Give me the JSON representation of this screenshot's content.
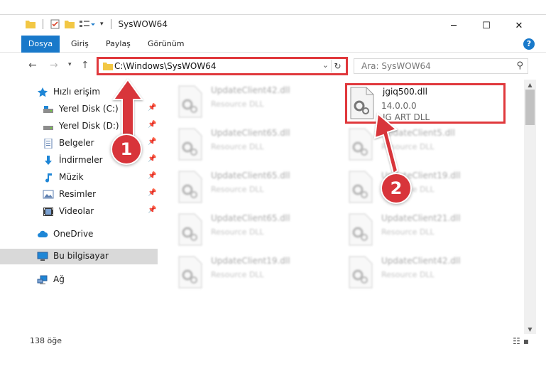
{
  "window": {
    "title": "SysWOW64",
    "controls": {
      "minimize": "─",
      "maximize": "☐",
      "close": "✕"
    }
  },
  "ribbon": {
    "tabs": [
      "Dosya",
      "Giriş",
      "Paylaş",
      "Görünüm"
    ],
    "help": "?"
  },
  "address": {
    "path": "C:\\Windows\\SysWOW64",
    "search_placeholder": "Ara: SysWOW64"
  },
  "sidebar": {
    "quick_access": "Hızlı erişim",
    "pinned": [
      {
        "label": "Yerel Disk (C:)",
        "icon": "drive-icon"
      },
      {
        "label": "Yerel Disk (D:)",
        "icon": "drive-icon"
      },
      {
        "label": "Belgeler",
        "icon": "documents-icon"
      },
      {
        "label": "İndirmeler",
        "icon": "downloads-icon"
      },
      {
        "label": "Müzik",
        "icon": "music-icon"
      },
      {
        "label": "Resimler",
        "icon": "pictures-icon"
      },
      {
        "label": "Videolar",
        "icon": "videos-icon"
      }
    ],
    "onedrive": "OneDrive",
    "this_pc": "Bu bilgisayar",
    "network": "Ağ"
  },
  "files": {
    "left": [
      {
        "name": "UpdateClient42.dll",
        "desc": "Resource DLL"
      },
      {
        "name": "UpdateClient65.dll",
        "desc": "Resource DLL"
      },
      {
        "name": "UpdateClient65.dll",
        "desc": "Resource DLL"
      },
      {
        "name": "UpdateClient65.dll",
        "desc": "Resource DLL"
      },
      {
        "name": "UpdateClient19.dll",
        "desc": "Resource DLL"
      }
    ],
    "right": [
      {
        "name": "UpdateClient5.dll",
        "desc": "Resource DLL"
      },
      {
        "name": "UpdateClient19.dll",
        "desc": "Resource DLL"
      },
      {
        "name": "UpdateClient21.dll",
        "desc": "Resource DLL"
      },
      {
        "name": "UpdateClient42.dll",
        "desc": "Resource DLL"
      }
    ],
    "target": {
      "name": "jgiq500.dll",
      "version": "14.0.0.0",
      "desc": "JG ART DLL"
    }
  },
  "status": {
    "count": "138 öğe"
  },
  "annotations": {
    "step1": "1",
    "step2": "2",
    "color": "#d8343a"
  }
}
